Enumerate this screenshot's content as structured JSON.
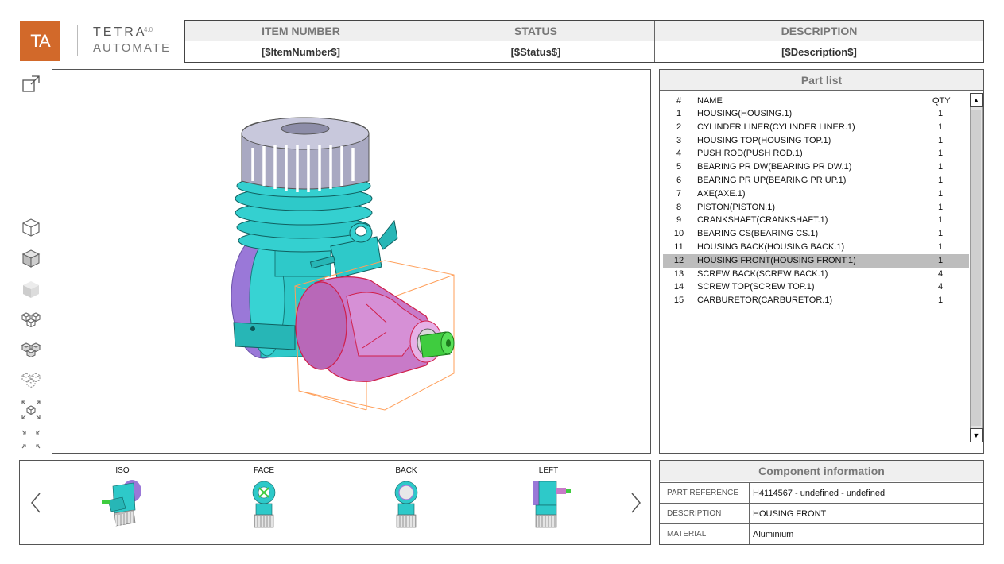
{
  "logo": {
    "mark": "TA",
    "word1": "TETRA",
    "superscript": "4.0",
    "word2": "AUTOMATE"
  },
  "header": {
    "columns": [
      {
        "label": "ITEM NUMBER",
        "value": "[$ItemNumber$]"
      },
      {
        "label": "STATUS",
        "value": "[$Status$]"
      },
      {
        "label": "DESCRIPTION",
        "value": "[$Description$]"
      }
    ]
  },
  "toolbar": {
    "icons": [
      "open-external-icon",
      "wireframe-cube-icon",
      "shaded-cube-icon",
      "solid-cube-icon",
      "explode-view-icon",
      "exploded-outline-icon",
      "hidden-lines-icon",
      "fit-all-icon",
      "collapse-icon"
    ]
  },
  "viewer": {
    "accent": "#ff9f5a",
    "model_color": "#2ec9c9",
    "selected_color": "#c87ac8"
  },
  "part_list": {
    "title": "Part list",
    "headers": {
      "num": "#",
      "name": "NAME",
      "qty": "QTY"
    },
    "selected_index": 11,
    "rows": [
      {
        "num": "1",
        "name": "HOUSING(HOUSING.1)",
        "qty": "1"
      },
      {
        "num": "2",
        "name": "CYLINDER LINER(CYLINDER LINER.1)",
        "qty": "1"
      },
      {
        "num": "3",
        "name": "HOUSING TOP(HOUSING TOP.1)",
        "qty": "1"
      },
      {
        "num": "4",
        "name": "PUSH ROD(PUSH ROD.1)",
        "qty": "1"
      },
      {
        "num": "5",
        "name": "BEARING PR DW(BEARING PR DW.1)",
        "qty": "1"
      },
      {
        "num": "6",
        "name": "BEARING PR UP(BEARING PR UP.1)",
        "qty": "1"
      },
      {
        "num": "7",
        "name": "AXE(AXE.1)",
        "qty": "1"
      },
      {
        "num": "8",
        "name": "PISTON(PISTON.1)",
        "qty": "1"
      },
      {
        "num": "9",
        "name": "CRANKSHAFT(CRANKSHAFT.1)",
        "qty": "1"
      },
      {
        "num": "10",
        "name": "BEARING CS(BEARING CS.1)",
        "qty": "1"
      },
      {
        "num": "11",
        "name": "HOUSING BACK(HOUSING BACK.1)",
        "qty": "1"
      },
      {
        "num": "12",
        "name": "HOUSING FRONT(HOUSING FRONT.1)",
        "qty": "1"
      },
      {
        "num": "13",
        "name": "SCREW BACK(SCREW BACK.1)",
        "qty": "4"
      },
      {
        "num": "14",
        "name": "SCREW TOP(SCREW TOP.1)",
        "qty": "4"
      },
      {
        "num": "15",
        "name": "CARBURETOR(CARBURETOR.1)",
        "qty": "1"
      }
    ],
    "scroll_up_glyph": "▲",
    "scroll_down_glyph": "▼"
  },
  "views": {
    "items": [
      {
        "label": "ISO"
      },
      {
        "label": "FACE"
      },
      {
        "label": "BACK"
      },
      {
        "label": "LEFT"
      }
    ],
    "prev_icon": "chevron-left-icon",
    "next_icon": "chevron-right-icon"
  },
  "component_info": {
    "title": "Component information",
    "rows": [
      {
        "key": "PART REFERENCE",
        "value": "H4114567 - undefined - undefined"
      },
      {
        "key": "DESCRIPTION",
        "value": "HOUSING FRONT"
      },
      {
        "key": "MATERIAL",
        "value": "Aluminium"
      }
    ]
  }
}
